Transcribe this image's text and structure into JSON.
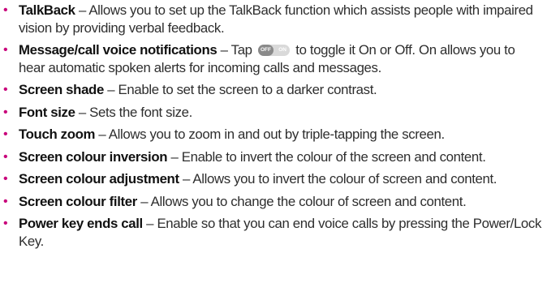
{
  "items": [
    {
      "term": "TalkBack",
      "desc": " – Allows you to set up the TalkBack function which assists people with impaired vision by providing verbal feedback."
    },
    {
      "term": "Message/call voice notifications",
      "desc_before": " – Tap ",
      "toggle": {
        "off_label": "OFF",
        "on_label": "ON"
      },
      "desc_after": " to toggle it On or Off. On allows you to hear automatic spoken alerts for incoming calls and messages."
    },
    {
      "term": "Screen shade",
      "desc": " – Enable to set the screen to a darker contrast."
    },
    {
      "term": "Font size",
      "desc": " – Sets the font size."
    },
    {
      "term": "Touch zoom",
      "desc": " – Allows you to zoom in and out by triple-tapping the screen."
    },
    {
      "term": "Screen colour inversion",
      "desc": " – Enable to invert the colour of the screen and content."
    },
    {
      "term": "Screen colour adjustment",
      "desc": " – Allows you to invert the colour of screen and content."
    },
    {
      "term": "Screen colour filter",
      "desc": " – Allows you to change the colour of screen and content."
    },
    {
      "term": "Power key ends call",
      "desc": " – Enable so that you can end voice calls by pressing the Power/Lock Key."
    }
  ],
  "colors": {
    "bullet": "#c8007a",
    "text": "#2e2e2e",
    "term": "#111111",
    "toggle_knob": "#8a8a8a",
    "toggle_track": "#d9d9d9"
  }
}
